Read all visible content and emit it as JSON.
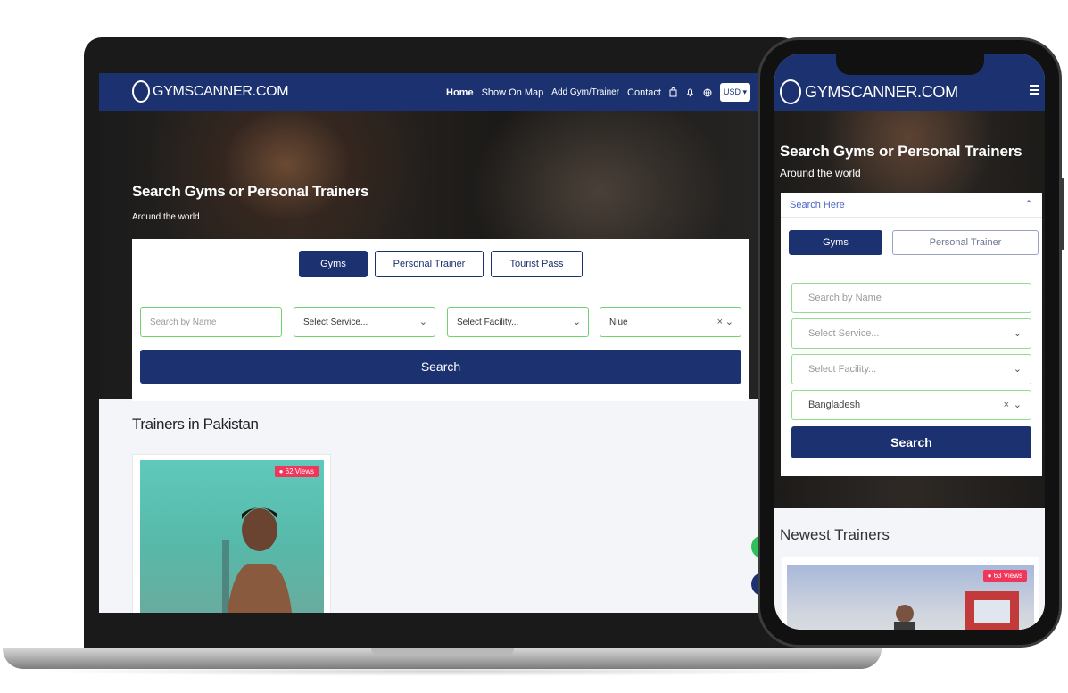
{
  "laptop": {
    "brand": "GYMSCANNER.COM",
    "nav": {
      "home": "Home",
      "show_on_map": "Show On Map",
      "add_gym": "Add Gym/Trainer",
      "contact": "Contact",
      "currency": "USD ▾"
    },
    "hero": {
      "title": "Search Gyms or Personal Trainers",
      "subtitle": "Around the world"
    },
    "tabs": [
      "Gyms",
      "Personal Trainer",
      "Tourist Pass"
    ],
    "fields": {
      "name_placeholder": "Search by Name",
      "service": "Select Service...",
      "facility": "Select Facility...",
      "country": "Niue"
    },
    "search_button": "Search",
    "section_title": "Trainers in Pakistan",
    "trainer_views": "● 62 Views"
  },
  "phone": {
    "brand": "GYMSCANNER.COM",
    "hero": {
      "title": "Search Gyms or Personal Trainers",
      "subtitle": "Around the world"
    },
    "search_here": "Search Here",
    "tabs": [
      "Gyms",
      "Personal Trainer"
    ],
    "fields": {
      "name_placeholder": "Search by Name",
      "service": "Select Service...",
      "facility": "Select Facility...",
      "country": "Bangladesh"
    },
    "search_button": "Search",
    "section_title": "Newest Trainers",
    "trainer_views": "● 63 Views"
  },
  "icons": {
    "chevron": "⌄",
    "clear": "×",
    "collapse": "⌃"
  },
  "colors": {
    "brand_navy": "#1c3170",
    "field_border": "#6fd36f",
    "views_badge": "#f0365a"
  }
}
